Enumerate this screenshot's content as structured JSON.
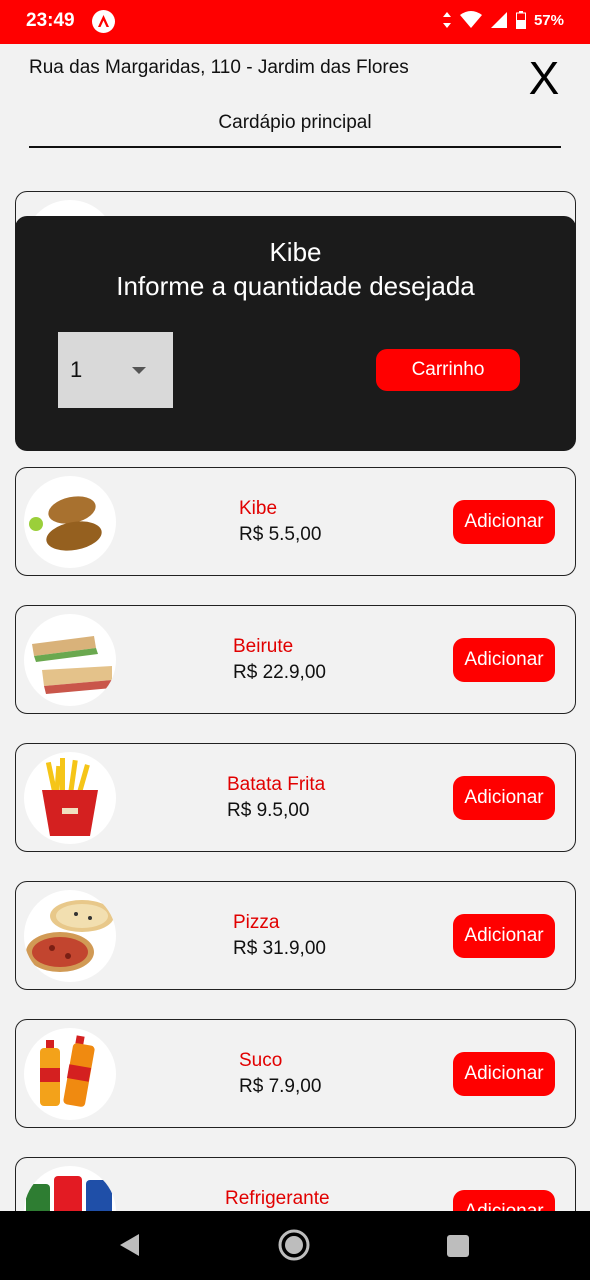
{
  "status_bar": {
    "time": "23:49",
    "battery": "57%"
  },
  "header": {
    "address": "Rua das Margaridas, 110 - Jardim das Flores",
    "close_label": "X",
    "tab_label": "Cardápio principal"
  },
  "dialog": {
    "item_name": "Kibe",
    "prompt": "Informe a quantidade desejada",
    "quantity": "1",
    "cart_button": "Carrinho"
  },
  "products": [
    {
      "name": "Kibe",
      "price": "R$ 5.5,00",
      "button": "Adicionar",
      "image": "kibe-image"
    },
    {
      "name": "Beirute",
      "price": "R$ 22.9,00",
      "button": "Adicionar",
      "image": "sandwich-image"
    },
    {
      "name": "Batata Frita",
      "price": "R$ 9.5,00",
      "button": "Adicionar",
      "image": "fries-image"
    },
    {
      "name": "Pizza",
      "price": "R$ 31.9,00",
      "button": "Adicionar",
      "image": "pizza-image"
    },
    {
      "name": "Suco",
      "price": "R$ 7.9,00",
      "button": "Adicionar",
      "image": "juice-image"
    },
    {
      "name": "Refrigerante",
      "price": "",
      "button": "Adicionar",
      "image": "soda-image"
    }
  ],
  "colors": {
    "accent": "#ff0000",
    "product_name": "#e10000",
    "dialog_bg": "#1b1b1b",
    "page_bg": "#f2f2f2"
  },
  "nav_icons": [
    "back-icon",
    "home-icon",
    "recent-apps-icon"
  ]
}
